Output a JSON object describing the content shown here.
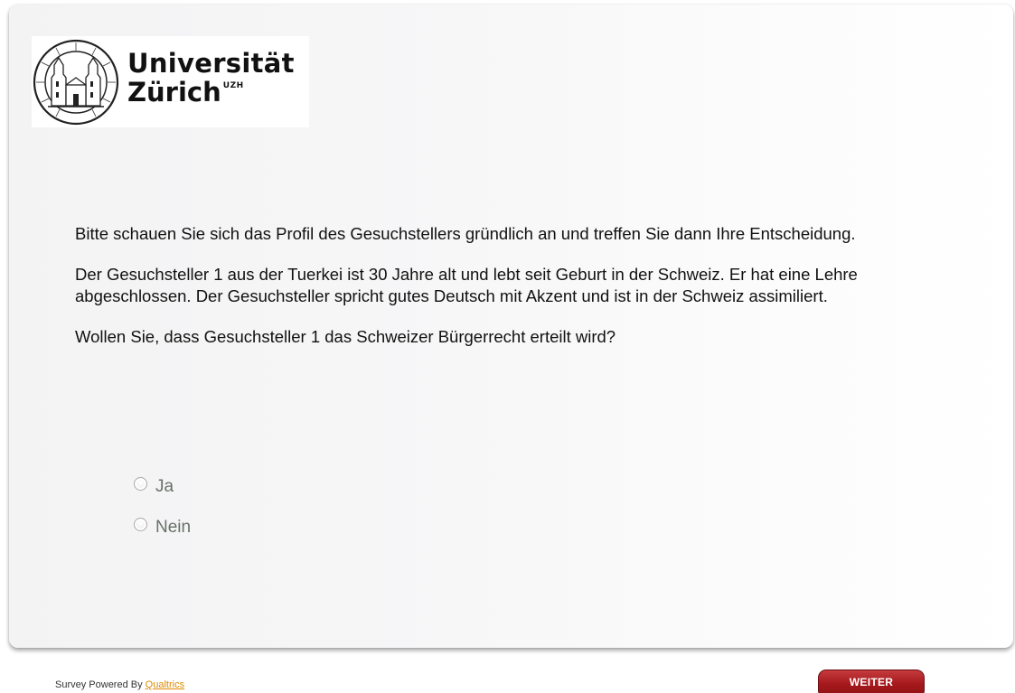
{
  "logo": {
    "line1": "Universität",
    "line2": "Zürich",
    "superscript": "UZH",
    "seal_icon": "university-seal-icon"
  },
  "question": {
    "intro": "Bitte schauen Sie sich das Profil des Gesuchstellers gründlich an und treffen Sie dann Ihre Entscheidung.",
    "profile": "Der Gesuchsteller 1 aus der Tuerkei ist 30 Jahre alt und lebt seit Geburt in der Schweiz. Er hat eine Lehre abgeschlossen. Der Gesuchsteller spricht gutes Deutsch mit Akzent und ist in der Schweiz assimiliert.",
    "prompt": "Wollen Sie, dass Gesuchsteller 1 das Schweizer Bürgerrecht erteilt wird?"
  },
  "choices": [
    {
      "label": "Ja",
      "selected": false
    },
    {
      "label": "Nein",
      "selected": false
    }
  ],
  "footer": {
    "powered_by": "Survey Powered By",
    "link_text": "Qualtrics"
  },
  "navigation": {
    "next_label": "WEITER"
  },
  "colors": {
    "button": "#a6191c",
    "link": "#e08a00",
    "choice_text": "#687068"
  }
}
